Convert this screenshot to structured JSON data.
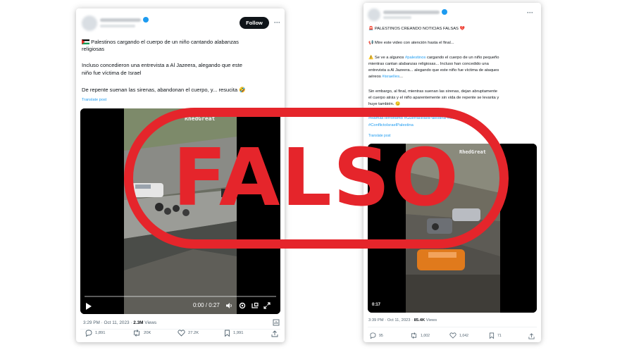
{
  "tweet1": {
    "follow_label": "Follow",
    "more_label": "···",
    "line1": "Palestinos cargando el cuerpo de un niño cantando alabanzas",
    "line2": "religiosas",
    "line3": "Incluso concedieron una entrevista a Al Jazeera, alegando que este",
    "line4": "niño fue víctima de Israel",
    "line5": "De repente suenan las sirenas, abandonan el cuerpo, y... resucita",
    "laugh_emoji": "🤣",
    "translate": "Translate post",
    "watermark": "RhedGreat",
    "player_time": "0:00 / 0:27",
    "posted_at": "3:29 PM · Oct 11, 2023 ·",
    "views_count": "2.3M",
    "views_label": "Views",
    "replies": "1,891",
    "reposts": "20K",
    "likes": "27.2K",
    "bookmarks": "1,991"
  },
  "tweet2": {
    "more_label": "···",
    "siren_emoji": "🚨",
    "headline": "PALESTINOS CREANDO NOTICIAS FALSAS",
    "heart_emoji": "💔",
    "megaphone_emoji": "📢",
    "watch_line": "Mire este video con atención hasta el final...",
    "warning_emoji": "⚠️",
    "p1_a": "Se ve a algunos",
    "tag_palestinos": "#palestinos",
    "p1_b": "cargando el cuerpo de un niño pequeño",
    "p1_line2": "mientras cantan alabanzas religiosas... Incluso han concedido una",
    "p1_line3": "entrevista a Al Jazeera... alegando que este niño fue víctima de ataques",
    "p1_line4_a": "aéreos",
    "tag_israelies": "#israelíes",
    "p1_line4_b": "...",
    "p2_line1": "Sin embargo, al final, mientras suenan las sirenas, dejan abruptamente",
    "p2_line2": "el cuerpo atrás y el niño aparentemente sin vida de repente se levanta y",
    "p2_line3": "huye también.",
    "smile_emoji": "😏",
    "tags_line1": "#HamasTerrorismo #GuerraIsraelPalestina #GazaE",
    "tags_line2": "#ConflictoIsraelPalestina",
    "translate": "Translate post",
    "watermark": "RhedGreat",
    "video_time": "0:17",
    "posted_at": "3:39 PM · Oct 11, 2023 ·",
    "views_count": "85.4K",
    "views_label": "Views",
    "replies": "95",
    "reposts": "1,002",
    "likes": "1,042",
    "bookmarks": "71"
  },
  "stamp": {
    "word": "FALSO",
    "color": "#e5252b"
  },
  "colors": {
    "link": "#1d9bf0",
    "text": "#0f1419",
    "muted": "#536471"
  }
}
